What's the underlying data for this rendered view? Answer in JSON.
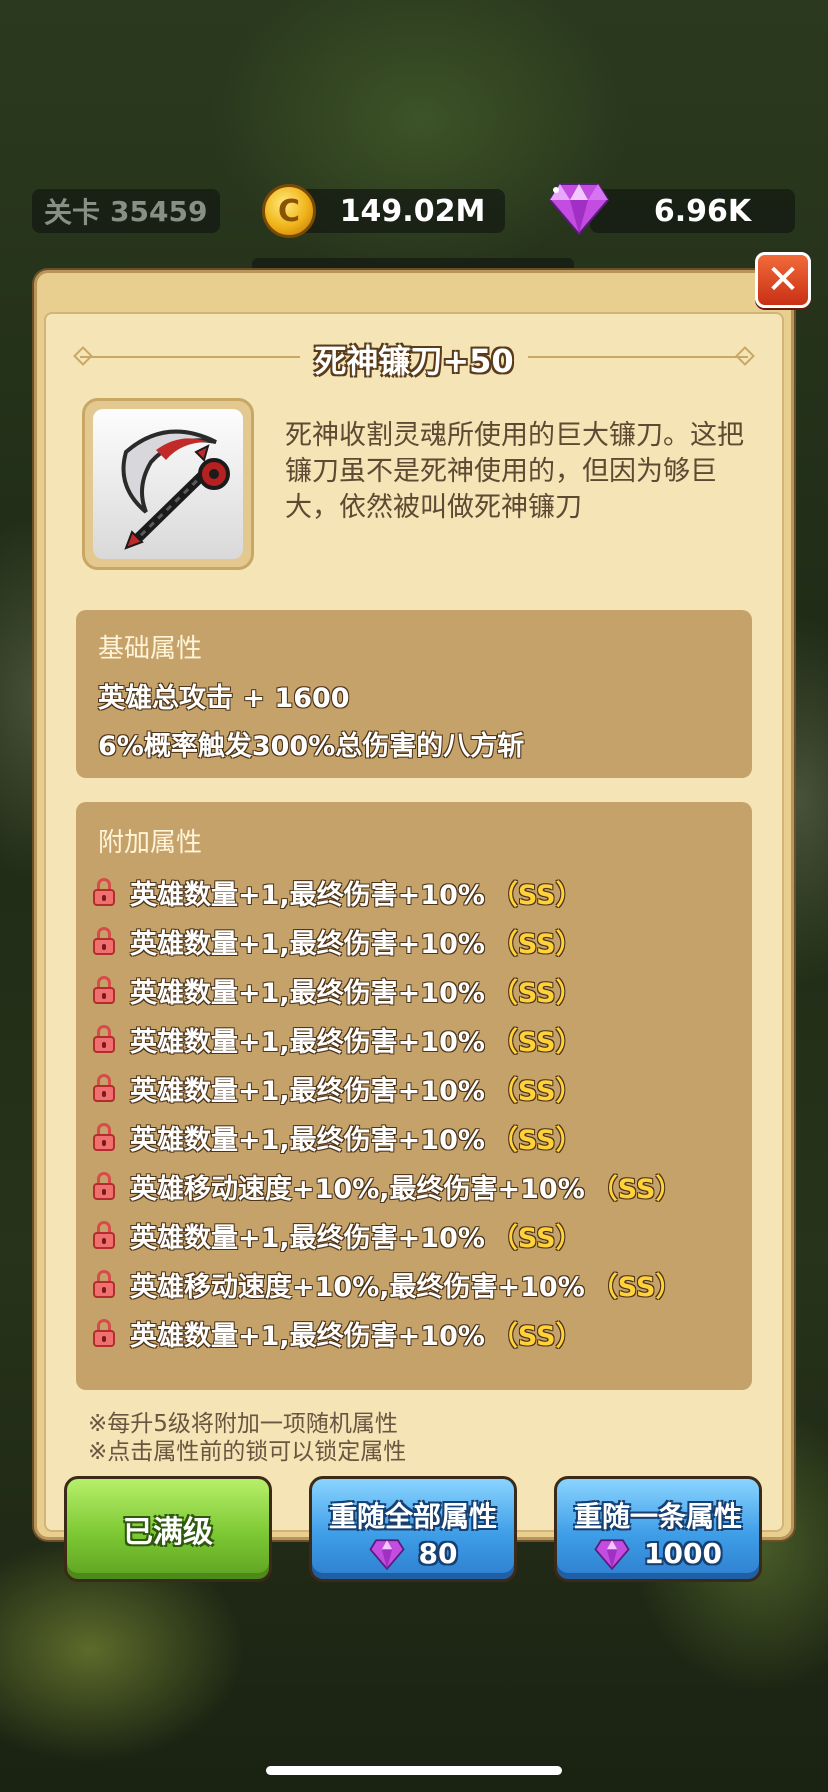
{
  "header": {
    "level_label": "关卡",
    "level_value": "35459",
    "gold": "149.02M",
    "gems": "6.96K",
    "coin_symbol": "C"
  },
  "dialog": {
    "close_symbol": "✕",
    "title": "死神镰刀+50",
    "item_icon": "scythe-icon",
    "description": "死神收割灵魂所使用的巨大镰刀。这把镰刀虽不是死神使用的，但因为够巨大，依然被叫做死神镰刀"
  },
  "base_attributes": {
    "label": "基础属性",
    "lines": [
      "英雄总攻击 + 1600",
      "6%概率触发300%总伤害的八方斩"
    ]
  },
  "extra_attributes": {
    "label": "附加属性",
    "items": [
      {
        "text": "英雄数量+1,最终伤害+10%",
        "grade": "（SS）"
      },
      {
        "text": "英雄数量+1,最终伤害+10%",
        "grade": "（SS）"
      },
      {
        "text": "英雄数量+1,最终伤害+10%",
        "grade": "（SS）"
      },
      {
        "text": "英雄数量+1,最终伤害+10%",
        "grade": "（SS）"
      },
      {
        "text": "英雄数量+1,最终伤害+10%",
        "grade": "（SS）"
      },
      {
        "text": "英雄数量+1,最终伤害+10%",
        "grade": "（SS）"
      },
      {
        "text": "英雄移动速度+10%,最终伤害+10%",
        "grade": "（SS）"
      },
      {
        "text": "英雄数量+1,最终伤害+10%",
        "grade": "（SS）"
      },
      {
        "text": "英雄移动速度+10%,最终伤害+10%",
        "grade": "（SS）"
      },
      {
        "text": "英雄数量+1,最终伤害+10%",
        "grade": "（SS）"
      }
    ]
  },
  "notes": [
    "※每升5级将附加一项随机属性",
    "※点击属性前的锁可以锁定属性"
  ],
  "buttons": {
    "max_level": "已满级",
    "reroll_all": {
      "label": "重随全部属性",
      "cost": "80"
    },
    "reroll_one": {
      "label": "重随一条属性",
      "cost": "1000"
    }
  },
  "colors": {
    "grade": "#ffd23a",
    "lock": "#f07070",
    "panel": "#f4e4b6",
    "section": "#c5a26a",
    "button_green": "#7dc834",
    "button_blue": "#3f9ee8"
  }
}
